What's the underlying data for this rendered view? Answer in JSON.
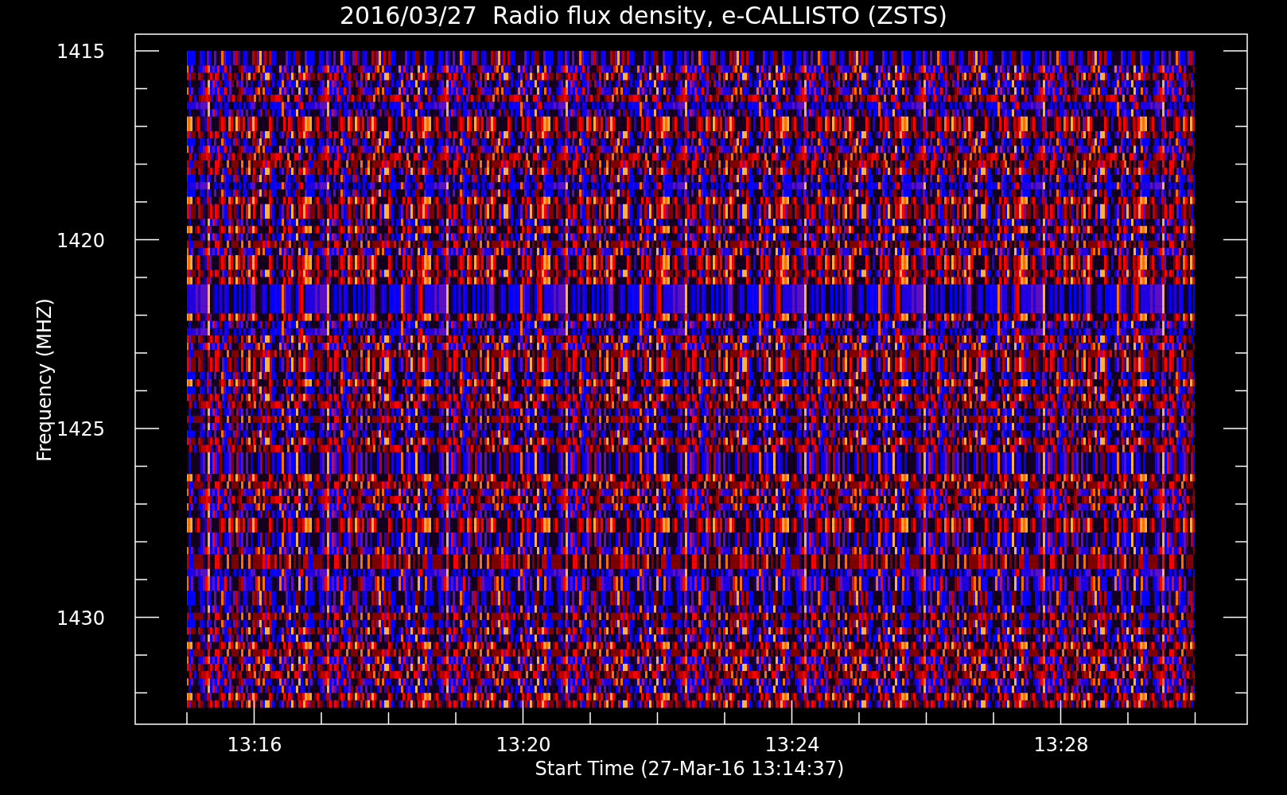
{
  "title": "2016/03/27  Radio flux density, e-CALLISTO (ZSTS)",
  "y_axis": {
    "label": "Frequency (MHZ)",
    "ticks": [
      "1415",
      "1420",
      "1425",
      "1430"
    ]
  },
  "x_axis": {
    "label": "Start Time (27-Mar-16 13:14:37)",
    "ticks": [
      "13:16",
      "13:20",
      "13:24",
      "13:28"
    ]
  }
}
